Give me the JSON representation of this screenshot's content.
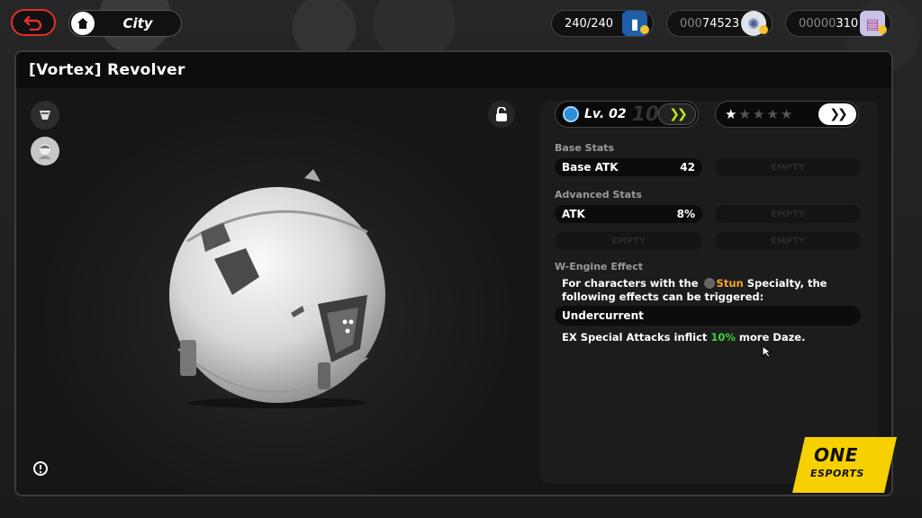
{
  "breadcrumb": {
    "location": "City"
  },
  "currencies": [
    {
      "value": "240/240",
      "icon": "battery-icon"
    },
    {
      "dim": "000",
      "value": "74523",
      "icon": "denny-coin-icon"
    },
    {
      "dim": "00000",
      "value": "310",
      "icon": "film-icon"
    }
  ],
  "panel": {
    "title": "[Vortex] Revolver"
  },
  "level": {
    "label": "Lv. 02",
    "max": "10"
  },
  "stars": {
    "filled": 1,
    "total": 5
  },
  "base_stats": {
    "title": "Base Stats",
    "rows": [
      {
        "name": "Base ATK",
        "value": "42"
      }
    ],
    "empty_label": "EMPTY"
  },
  "advanced_stats": {
    "title": "Advanced Stats",
    "rows": [
      {
        "name": "ATK",
        "value": "8%"
      }
    ],
    "empty_label": "EMPTY"
  },
  "effect": {
    "title": "W-Engine Effect",
    "line1_a": "For characters with the ",
    "specialty": "Stun",
    "line1_b": " Specialty, the",
    "line2": "following effects can be triggered:",
    "name": "Undercurrent",
    "desc_a": "EX Special Attacks inflict ",
    "desc_pct": "10%",
    "desc_b": " more Daze."
  },
  "logo": {
    "line1": "ONE",
    "line2": "ESPORTS"
  },
  "colors": {
    "accent_red": "#e0312b",
    "level_green": "#b9e61a",
    "stun_orange": "#f4a623",
    "daze_green": "#3ed43e",
    "logo_yellow": "#f6d000"
  }
}
